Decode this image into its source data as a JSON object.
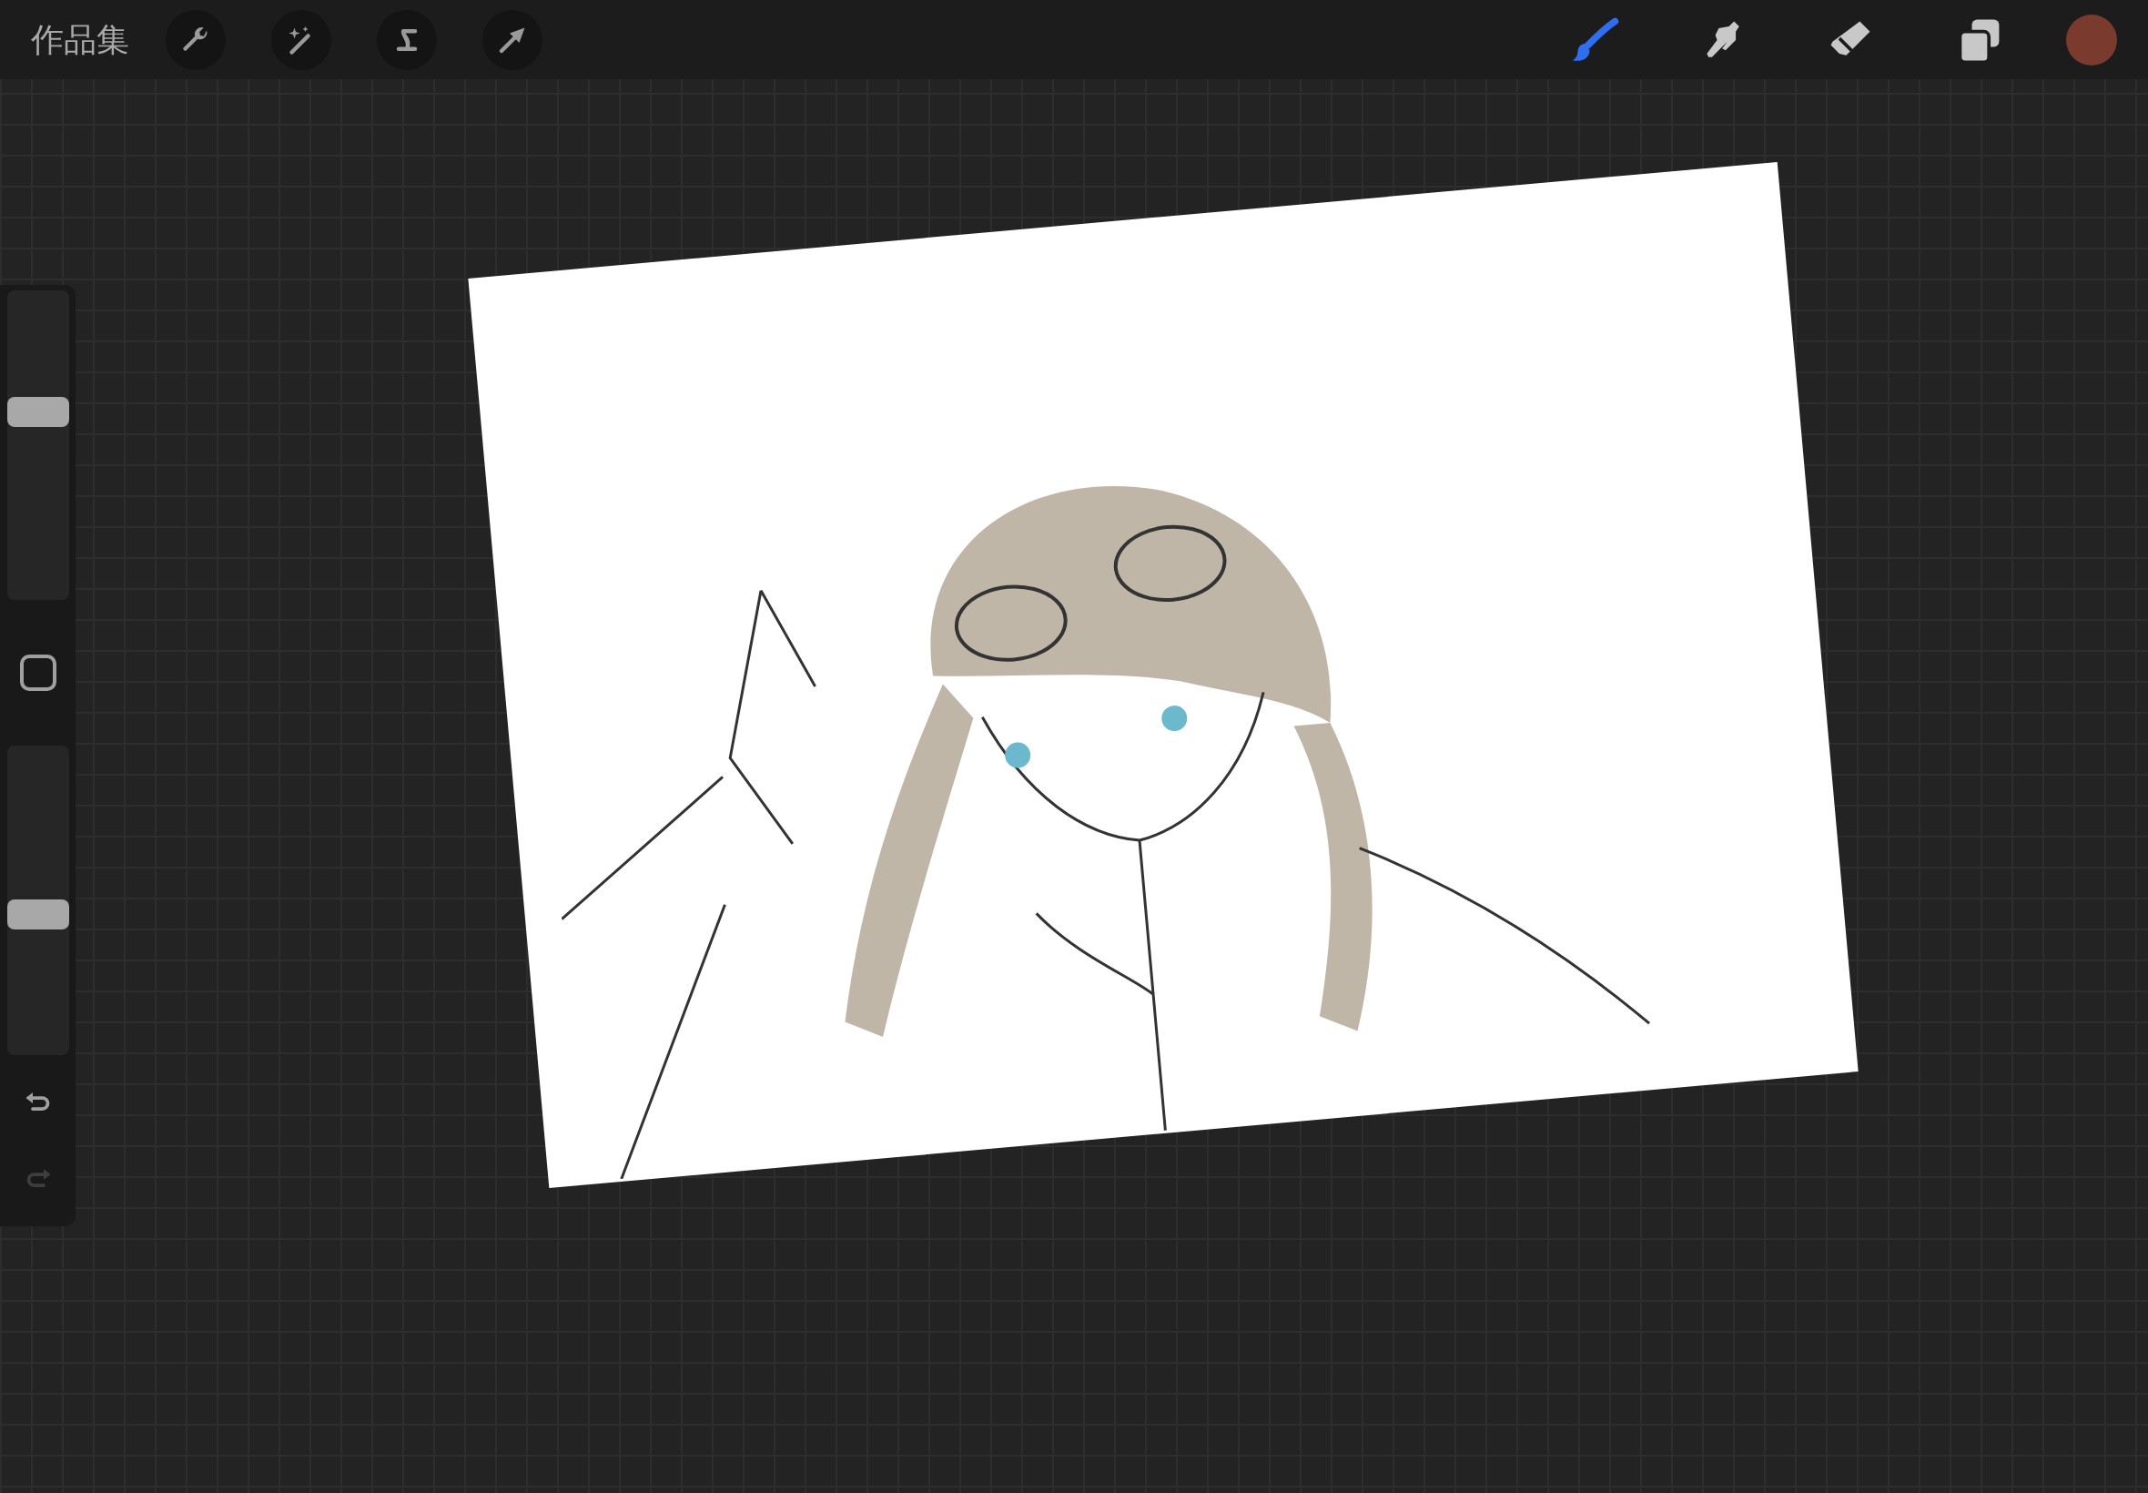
{
  "top_bar": {
    "title": "作品集",
    "tools": [
      {
        "kind": "brush",
        "selected": true
      },
      {
        "kind": "smudge",
        "selected": false
      },
      {
        "kind": "eraser",
        "selected": false
      },
      {
        "kind": "layers",
        "selected": false
      }
    ],
    "current_color": {
      "color": "#7a3a2e"
    }
  },
  "sidebar": {
    "sliders": [
      {
        "level": 0.62
      },
      {
        "level": 0.45
      }
    ],
    "undo": {
      "disabled": false
    },
    "redo": {
      "disabled": true
    }
  }
}
